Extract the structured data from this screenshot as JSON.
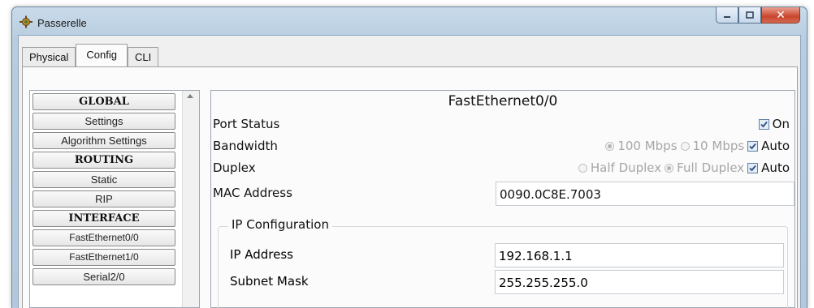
{
  "window": {
    "title": "Passerelle",
    "icon": "router-gear-icon"
  },
  "tabs": [
    {
      "label": "Physical"
    },
    {
      "label": "Config"
    },
    {
      "label": "CLI"
    }
  ],
  "nav": {
    "items": [
      {
        "label": "GLOBAL"
      },
      {
        "label": "Settings"
      },
      {
        "label": "Algorithm Settings"
      },
      {
        "label": "ROUTING"
      },
      {
        "label": "Static"
      },
      {
        "label": "RIP"
      },
      {
        "label": "INTERFACE"
      },
      {
        "label": "FastEthernet0/0"
      },
      {
        "label": "FastEthernet1/0"
      },
      {
        "label": "Serial2/0"
      }
    ]
  },
  "panel": {
    "title": "FastEthernet0/0",
    "port_status": {
      "label": "Port Status",
      "on_label": "On",
      "on_checked": true
    },
    "bandwidth": {
      "label": "Bandwidth",
      "opt1": "100 Mbps",
      "opt2": "10 Mbps",
      "auto": "Auto"
    },
    "duplex": {
      "label": "Duplex",
      "opt1": "Half Duplex",
      "opt2": "Full Duplex",
      "auto": "Auto"
    },
    "mac": {
      "label": "MAC Address",
      "value": "0090.0C8E.7003"
    },
    "ip_config": {
      "legend": "IP Configuration",
      "ip_label": "IP Address",
      "ip_value": "192.168.1.1",
      "mask_label": "Subnet Mask",
      "mask_value": "255.255.255.0"
    }
  }
}
